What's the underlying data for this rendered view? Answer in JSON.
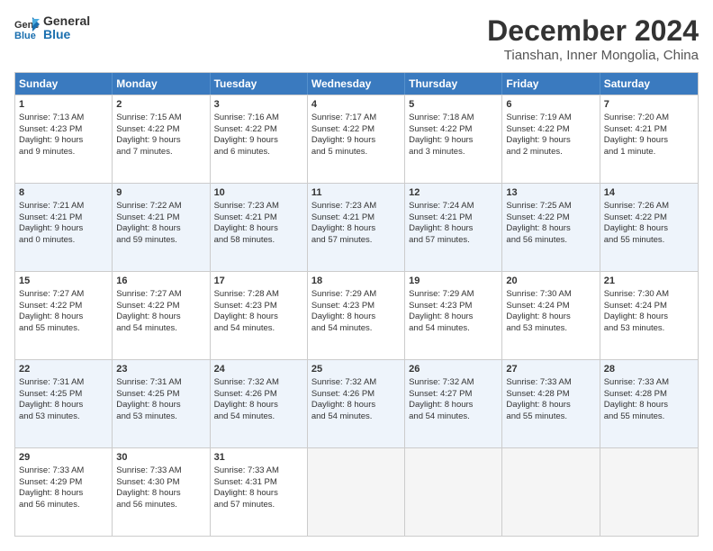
{
  "header": {
    "logo_line1": "General",
    "logo_line2": "Blue",
    "main_title": "December 2024",
    "subtitle": "Tianshan, Inner Mongolia, China"
  },
  "days": [
    "Sunday",
    "Monday",
    "Tuesday",
    "Wednesday",
    "Thursday",
    "Friday",
    "Saturday"
  ],
  "rows": [
    [
      {
        "num": "1",
        "lines": [
          "Sunrise: 7:13 AM",
          "Sunset: 4:23 PM",
          "Daylight: 9 hours",
          "and 9 minutes."
        ]
      },
      {
        "num": "2",
        "lines": [
          "Sunrise: 7:15 AM",
          "Sunset: 4:22 PM",
          "Daylight: 9 hours",
          "and 7 minutes."
        ]
      },
      {
        "num": "3",
        "lines": [
          "Sunrise: 7:16 AM",
          "Sunset: 4:22 PM",
          "Daylight: 9 hours",
          "and 6 minutes."
        ]
      },
      {
        "num": "4",
        "lines": [
          "Sunrise: 7:17 AM",
          "Sunset: 4:22 PM",
          "Daylight: 9 hours",
          "and 5 minutes."
        ]
      },
      {
        "num": "5",
        "lines": [
          "Sunrise: 7:18 AM",
          "Sunset: 4:22 PM",
          "Daylight: 9 hours",
          "and 3 minutes."
        ]
      },
      {
        "num": "6",
        "lines": [
          "Sunrise: 7:19 AM",
          "Sunset: 4:22 PM",
          "Daylight: 9 hours",
          "and 2 minutes."
        ]
      },
      {
        "num": "7",
        "lines": [
          "Sunrise: 7:20 AM",
          "Sunset: 4:21 PM",
          "Daylight: 9 hours",
          "and 1 minute."
        ]
      }
    ],
    [
      {
        "num": "8",
        "lines": [
          "Sunrise: 7:21 AM",
          "Sunset: 4:21 PM",
          "Daylight: 9 hours",
          "and 0 minutes."
        ]
      },
      {
        "num": "9",
        "lines": [
          "Sunrise: 7:22 AM",
          "Sunset: 4:21 PM",
          "Daylight: 8 hours",
          "and 59 minutes."
        ]
      },
      {
        "num": "10",
        "lines": [
          "Sunrise: 7:23 AM",
          "Sunset: 4:21 PM",
          "Daylight: 8 hours",
          "and 58 minutes."
        ]
      },
      {
        "num": "11",
        "lines": [
          "Sunrise: 7:23 AM",
          "Sunset: 4:21 PM",
          "Daylight: 8 hours",
          "and 57 minutes."
        ]
      },
      {
        "num": "12",
        "lines": [
          "Sunrise: 7:24 AM",
          "Sunset: 4:21 PM",
          "Daylight: 8 hours",
          "and 57 minutes."
        ]
      },
      {
        "num": "13",
        "lines": [
          "Sunrise: 7:25 AM",
          "Sunset: 4:22 PM",
          "Daylight: 8 hours",
          "and 56 minutes."
        ]
      },
      {
        "num": "14",
        "lines": [
          "Sunrise: 7:26 AM",
          "Sunset: 4:22 PM",
          "Daylight: 8 hours",
          "and 55 minutes."
        ]
      }
    ],
    [
      {
        "num": "15",
        "lines": [
          "Sunrise: 7:27 AM",
          "Sunset: 4:22 PM",
          "Daylight: 8 hours",
          "and 55 minutes."
        ]
      },
      {
        "num": "16",
        "lines": [
          "Sunrise: 7:27 AM",
          "Sunset: 4:22 PM",
          "Daylight: 8 hours",
          "and 54 minutes."
        ]
      },
      {
        "num": "17",
        "lines": [
          "Sunrise: 7:28 AM",
          "Sunset: 4:23 PM",
          "Daylight: 8 hours",
          "and 54 minutes."
        ]
      },
      {
        "num": "18",
        "lines": [
          "Sunrise: 7:29 AM",
          "Sunset: 4:23 PM",
          "Daylight: 8 hours",
          "and 54 minutes."
        ]
      },
      {
        "num": "19",
        "lines": [
          "Sunrise: 7:29 AM",
          "Sunset: 4:23 PM",
          "Daylight: 8 hours",
          "and 54 minutes."
        ]
      },
      {
        "num": "20",
        "lines": [
          "Sunrise: 7:30 AM",
          "Sunset: 4:24 PM",
          "Daylight: 8 hours",
          "and 53 minutes."
        ]
      },
      {
        "num": "21",
        "lines": [
          "Sunrise: 7:30 AM",
          "Sunset: 4:24 PM",
          "Daylight: 8 hours",
          "and 53 minutes."
        ]
      }
    ],
    [
      {
        "num": "22",
        "lines": [
          "Sunrise: 7:31 AM",
          "Sunset: 4:25 PM",
          "Daylight: 8 hours",
          "and 53 minutes."
        ]
      },
      {
        "num": "23",
        "lines": [
          "Sunrise: 7:31 AM",
          "Sunset: 4:25 PM",
          "Daylight: 8 hours",
          "and 53 minutes."
        ]
      },
      {
        "num": "24",
        "lines": [
          "Sunrise: 7:32 AM",
          "Sunset: 4:26 PM",
          "Daylight: 8 hours",
          "and 54 minutes."
        ]
      },
      {
        "num": "25",
        "lines": [
          "Sunrise: 7:32 AM",
          "Sunset: 4:26 PM",
          "Daylight: 8 hours",
          "and 54 minutes."
        ]
      },
      {
        "num": "26",
        "lines": [
          "Sunrise: 7:32 AM",
          "Sunset: 4:27 PM",
          "Daylight: 8 hours",
          "and 54 minutes."
        ]
      },
      {
        "num": "27",
        "lines": [
          "Sunrise: 7:33 AM",
          "Sunset: 4:28 PM",
          "Daylight: 8 hours",
          "and 55 minutes."
        ]
      },
      {
        "num": "28",
        "lines": [
          "Sunrise: 7:33 AM",
          "Sunset: 4:28 PM",
          "Daylight: 8 hours",
          "and 55 minutes."
        ]
      }
    ],
    [
      {
        "num": "29",
        "lines": [
          "Sunrise: 7:33 AM",
          "Sunset: 4:29 PM",
          "Daylight: 8 hours",
          "and 56 minutes."
        ]
      },
      {
        "num": "30",
        "lines": [
          "Sunrise: 7:33 AM",
          "Sunset: 4:30 PM",
          "Daylight: 8 hours",
          "and 56 minutes."
        ]
      },
      {
        "num": "31",
        "lines": [
          "Sunrise: 7:33 AM",
          "Sunset: 4:31 PM",
          "Daylight: 8 hours",
          "and 57 minutes."
        ]
      },
      null,
      null,
      null,
      null
    ]
  ]
}
